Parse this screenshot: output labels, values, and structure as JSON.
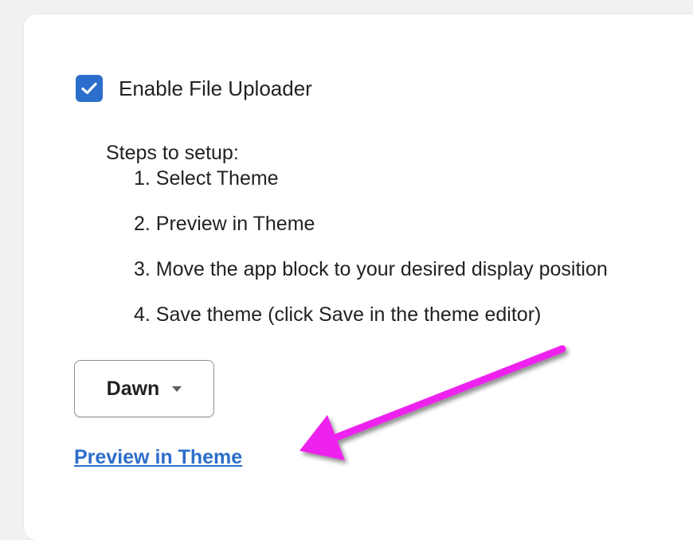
{
  "settings": {
    "enable_uploader": {
      "label": "Enable File Uploader",
      "checked": true
    },
    "steps": {
      "title": "Steps to setup:",
      "items": [
        "1. Select Theme",
        "2. Preview in Theme",
        "3. Move the app block to your desired display position",
        "4. Save theme (click Save in the theme editor)"
      ]
    },
    "theme_select": {
      "value": "Dawn"
    },
    "preview_link": {
      "label": "Preview in Theme"
    }
  },
  "colors": {
    "accent": "#2c6ecb",
    "annotation_arrow": "#ee22ee"
  }
}
